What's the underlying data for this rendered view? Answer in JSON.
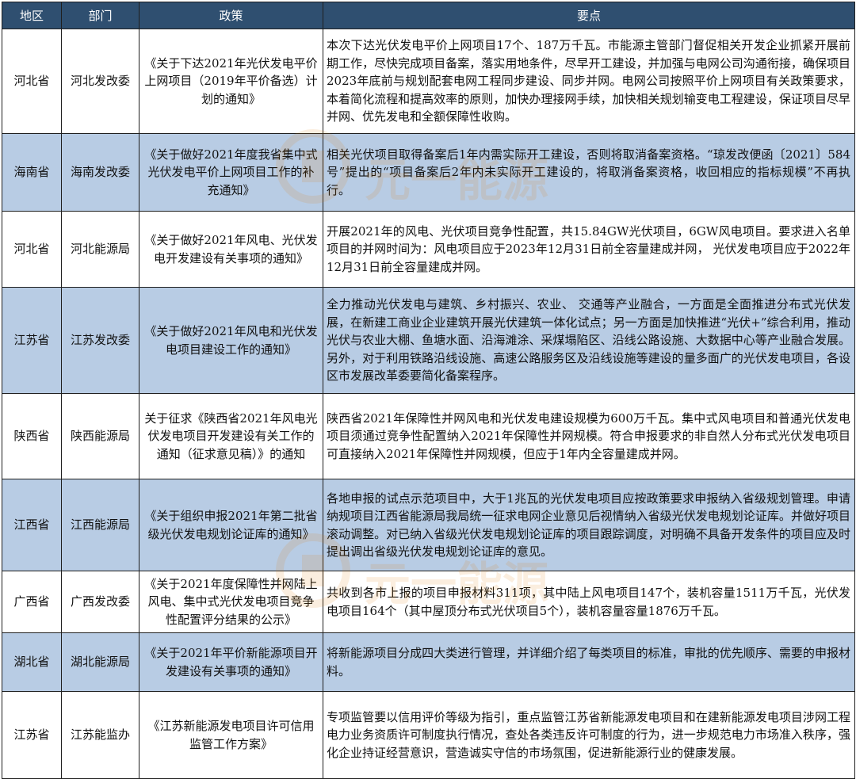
{
  "header": [
    "地区",
    "部门",
    "政策",
    "要点"
  ],
  "rows": [
    {
      "region": "河北省",
      "dept": "河北发改委",
      "policy": "《关于下达2021年光伏发电平价上网项目（2019年平价备选）计划的通知》",
      "points": "本次下达光伏发电平价上网项目17个、187万千瓦。市能源主管部门督促相关开发企业抓紧开展前期工作，尽快完成项目备案，落实用地条件，尽早开工建设，并加强与电网公司沟通衔接，确保项目2023年底前与规划配套电网工程同步建设、同步并网。电网公司按照平价上网项目有关政策要求，本着简化流程和提高效率的原则，加快办理接网手续，加快相关规划输变电工程建设，保证项目尽早并网、优先发电和全额保障性收购。",
      "style": "white"
    },
    {
      "region": "海南省",
      "dept": "海南发改委",
      "policy": "《关于做好2021年度我省集中式光伏发电平价上网项目工作的补充通知》",
      "points": "相关光伏项目取得备案后1年内需实际开工建设，否则将取消备案资格。“琼发改便函〔2021〕584号”提出的“项目备案后2年内未实际开工建设的，将取消备案资格，收回相应的指标规模”不再执行。",
      "style": "blue"
    },
    {
      "region": "河北省",
      "dept": "河北能源局",
      "policy": "《关于做好2021年风电、光伏发电开发建设有关事项的通知》",
      "points": "开展2021年的风电、光伏项目竞争性配置，共15.84GW光伏项目，6GW风电项目。要求进入名单项目的并网时间为：风电项目应于2023年12月31日前全容量建成并网， 光伏发电项目应于2022年12月31日前全容量建成并网。",
      "style": "white"
    },
    {
      "region": "江苏省",
      "dept": "江苏发改委",
      "policy": "《关于做好2021年风电和光伏发电项目建设工作的通知》",
      "points": "全力推动光伏发电与建筑、乡村振兴、农业、 交通等产业融合，一方面是全面推进分布式光伏发展，在新建工商业企业建筑开展光伏建筑一体化试点；另一方面是加快推进“光伏+”综合利用，推动光伏与农业大棚、鱼塘水面、沿海滩涂、采煤塌陷区、沿线公路设施、大数据中心等产业融合发展。另外，对于利用铁路沿线设施、高速公路服务区及沿线设施等建设的量多面广的光伏发电项目，各设区市发展改革委要简化备案程序。",
      "style": "blue"
    },
    {
      "region": "陕西省",
      "dept": "陕西能源局",
      "policy": "关于征求《陕西省2021年风电光伏发电项目开发建设有关工作的通知（征求意见稿）》的通知",
      "points": "陕西省2021年保障性并网风电和光伏发电建设规模为600万千瓦。集中式风电项目和普通光伏发电项目须通过竞争性配置纳入2021年保障性并网规模。符合申报要求的非自然人分布式光伏发电项目可直接纳入2021年保障性并网规模，但应于1年内全容量建成并网。",
      "style": "white"
    },
    {
      "region": "江西省",
      "dept": "江西能源局",
      "policy": "《关于组织申报2021年第二批省级光伏发电规划论证库的通知》",
      "points": "各地申报的试点示范项目中，大于1兆瓦的光伏发电项目应按政策要求申报纳入省级规划管理。申请纳规项目江西省能源局我局统一征求电网企业意见后视情纳入省级光伏发电规划论证库。并做好项目滚动调整。对已纳入省级光伏发电规划论证库的项目跟踪调度，对明确不具备开发条件的项目应及时提出调出省级光伏发电规划论证库的意见。",
      "style": "blue"
    },
    {
      "region": "广西省",
      "dept": "广西发改委",
      "policy": "《关于2021年度保障性并网陆上风电、集中式光伏发电项目竞争性配置评分结果的公示》",
      "points": "共收到各市上报的项目申报材料311项，其中陆上风电项目147个，装机容量1511万千瓦，光伏发电项目164个（其中屋顶分布式光伏项目5个），装机容量容量1876万千瓦。",
      "style": "white"
    },
    {
      "region": "湖北省",
      "dept": "湖北能源局",
      "policy": "《关于2021年平价新能源项目开发建设有关事项的通知》",
      "points": "将新能源项目分成四大类进行管理，并详细介绍了每类项目的标准，审批的优先顺序、需要的申报材料。",
      "style": "blue"
    },
    {
      "region": "江苏省",
      "dept": "江苏能监办",
      "policy": "《江苏新能源发电项目许可信用监管工作方案》",
      "points": "专项监管要以信用评价等级为指引，重点监管江苏省新能源发电项目和在建新能源发电项目涉网工程电力业务资质许可制度执行情况，查处各类违反许可制度的行为，进一步规范电力市场准入秩序，强化企业持证经营意识，营造诚实守信的市场氛围，促进新能源行业的健康发展。",
      "style": "white"
    }
  ],
  "watermark": {
    "text": "元一能源",
    "color": "#e07b00"
  }
}
